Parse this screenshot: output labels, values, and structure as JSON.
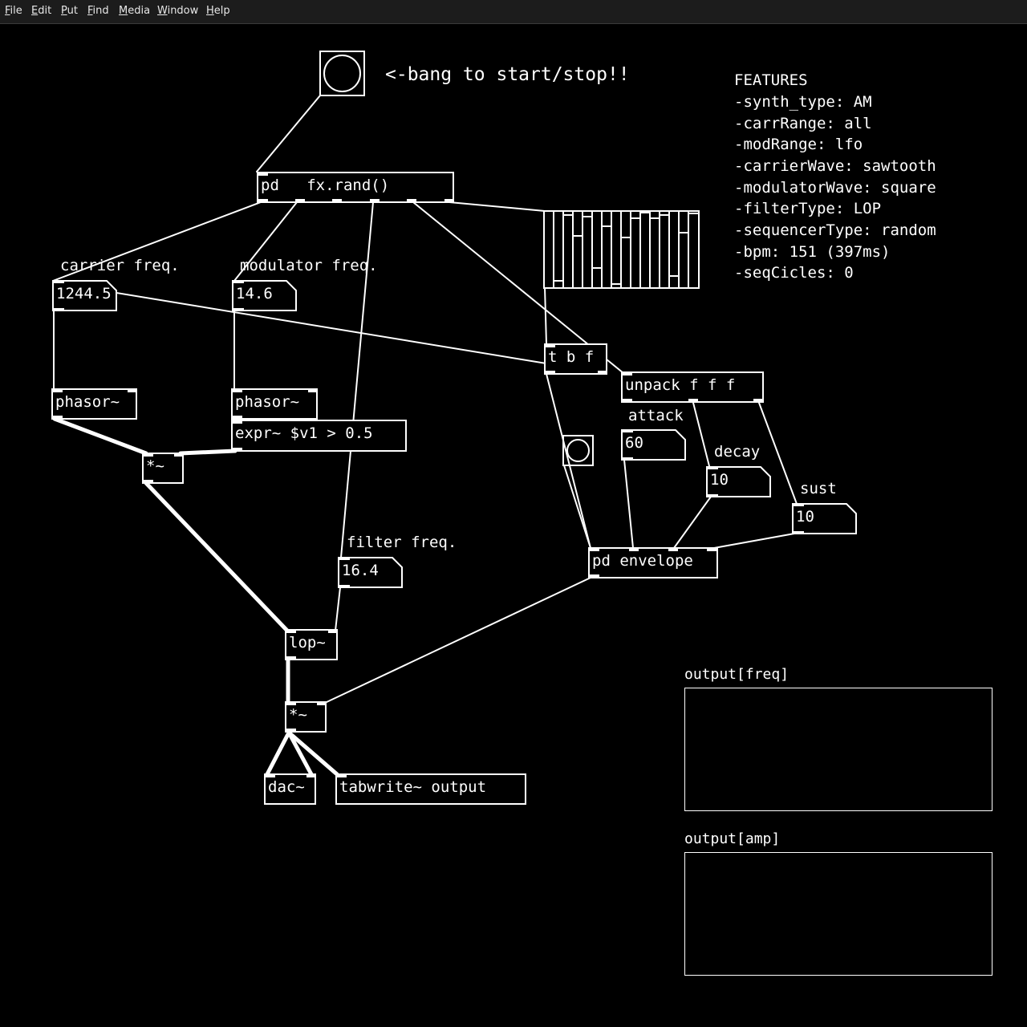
{
  "menu": [
    "File",
    "Edit",
    "Put",
    "Find",
    "Media",
    "Window",
    "Help"
  ],
  "start_label": "<-bang to start/stop!!",
  "features": {
    "title": "FEATURES",
    "lines": [
      "-synth_type: AM",
      "-carrRange: all",
      "-modRange: lfo",
      "-carrierWave: sawtooth",
      "-modulatorWave: square",
      "-filterType: LOP",
      "-sequencerType: random",
      "-bpm: 151 (397ms)",
      "-seqCicles: 0"
    ]
  },
  "objects": {
    "fxrand": "pd   fx.rand()",
    "phasor1": "phasor~",
    "phasor2": "phasor~",
    "expr": "expr~ $v1 > 0.5",
    "mul1": "*~",
    "tbf": "t b f",
    "unpack": "unpack f f f",
    "envelope": "pd envelope",
    "lop": "lop~",
    "mul2": "*~",
    "dac": "dac~",
    "tabwrite": "tabwrite~ output"
  },
  "labels": {
    "carrier": "carrier freq.",
    "modulator": "modulator freq.",
    "filter": "filter freq.",
    "attack": "attack",
    "decay": "decay",
    "sust": "sust"
  },
  "numbers": {
    "carrier": "1244.5",
    "modulator": "14.6",
    "filter": "16.4",
    "attack": "60",
    "decay": "10",
    "sust": "10"
  },
  "graphs": {
    "freq": "output[freq]",
    "amp": "output[amp]"
  },
  "colors": {
    "background": "#000000",
    "foreground": "#ffffff",
    "menubar": "#1c1c1c"
  }
}
